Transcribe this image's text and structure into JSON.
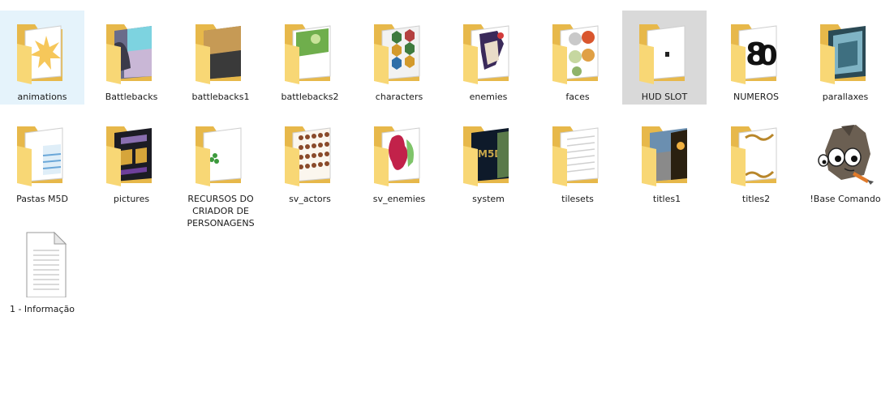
{
  "colors": {
    "selected_bg": "#e5f3fb",
    "hover_bg": "#d9d9d9",
    "folder_yellow": "#f8d775",
    "folder_dark": "#e7b84a"
  },
  "items": [
    {
      "label": "animations",
      "icon": "folder-preview-icon",
      "state": "selected"
    },
    {
      "label": "Battlebacks",
      "icon": "folder-preview-icon",
      "state": ""
    },
    {
      "label": "battlebacks1",
      "icon": "folder-preview-icon",
      "state": ""
    },
    {
      "label": "battlebacks2",
      "icon": "folder-preview-icon",
      "state": ""
    },
    {
      "label": "characters",
      "icon": "folder-preview-icon",
      "state": ""
    },
    {
      "label": "enemies",
      "icon": "folder-preview-icon",
      "state": ""
    },
    {
      "label": "faces",
      "icon": "folder-preview-icon",
      "state": ""
    },
    {
      "label": "HUD SLOT",
      "icon": "folder-preview-icon",
      "state": "hovered"
    },
    {
      "label": "NUMEROS",
      "icon": "folder-preview-icon",
      "state": ""
    },
    {
      "label": "parallaxes",
      "icon": "folder-preview-icon",
      "state": ""
    },
    {
      "label": "Pastas M5D",
      "icon": "folder-preview-icon",
      "state": ""
    },
    {
      "label": "pictures",
      "icon": "folder-preview-icon",
      "state": ""
    },
    {
      "label": "RECURSOS DO CRIADOR DE PERSONAGENS",
      "icon": "folder-preview-icon",
      "state": ""
    },
    {
      "label": "sv_actors",
      "icon": "folder-preview-icon",
      "state": ""
    },
    {
      "label": "sv_enemies",
      "icon": "folder-preview-icon",
      "state": ""
    },
    {
      "label": "system",
      "icon": "folder-preview-icon",
      "state": ""
    },
    {
      "label": "tilesets",
      "icon": "folder-preview-icon",
      "state": ""
    },
    {
      "label": "titles1",
      "icon": "folder-preview-icon",
      "state": ""
    },
    {
      "label": "titles2",
      "icon": "folder-preview-icon",
      "state": ""
    },
    {
      "label": "!Base Comando",
      "icon": "gimp-app-icon",
      "state": ""
    },
    {
      "label": "1 - Informação",
      "icon": "text-file-icon",
      "state": ""
    }
  ]
}
